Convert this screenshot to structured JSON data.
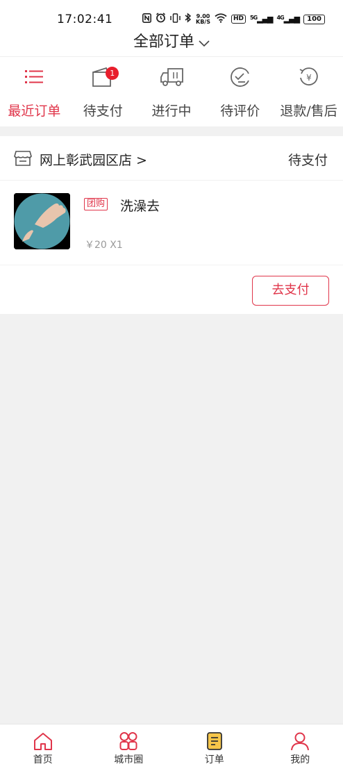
{
  "status_bar": {
    "time": "17:02:41",
    "net_speed_value": "9.00",
    "net_speed_unit": "KB/S",
    "hd_label": "HD",
    "signal_label_1": "5G",
    "signal_label_2": "4G",
    "battery": "100",
    "icons": [
      "nfc-icon",
      "alarm-icon",
      "vibrate-icon",
      "bluetooth-icon",
      "wifi-icon",
      "signal-icon",
      "battery-icon"
    ]
  },
  "header": {
    "title": "全部订单",
    "dropdown_icon": "chevron-down-icon"
  },
  "tabs": [
    {
      "label": "最近订单",
      "icon": "list-icon",
      "active": true
    },
    {
      "label": "待支付",
      "icon": "wallet-icon",
      "badge": "1"
    },
    {
      "label": "进行中",
      "icon": "truck-icon"
    },
    {
      "label": "待评价",
      "icon": "review-icon"
    },
    {
      "label": "退款/售后",
      "icon": "refund-icon"
    }
  ],
  "order": {
    "shop_name": "网上彰武园区店 >",
    "status": "待支付",
    "item": {
      "tag": "团购",
      "name": "洗澡去",
      "price": "￥20 X1"
    },
    "pay_button": "去支付"
  },
  "bottom_nav": [
    {
      "label": "首页",
      "icon": "home-icon"
    },
    {
      "label": "城市圈",
      "icon": "city-circle-icon"
    },
    {
      "label": "订单",
      "icon": "order-icon"
    },
    {
      "label": "我的",
      "icon": "profile-icon"
    }
  ],
  "colors": {
    "accent": "#e0354a",
    "badge": "#e81e2c",
    "background": "#f1f1f1"
  }
}
